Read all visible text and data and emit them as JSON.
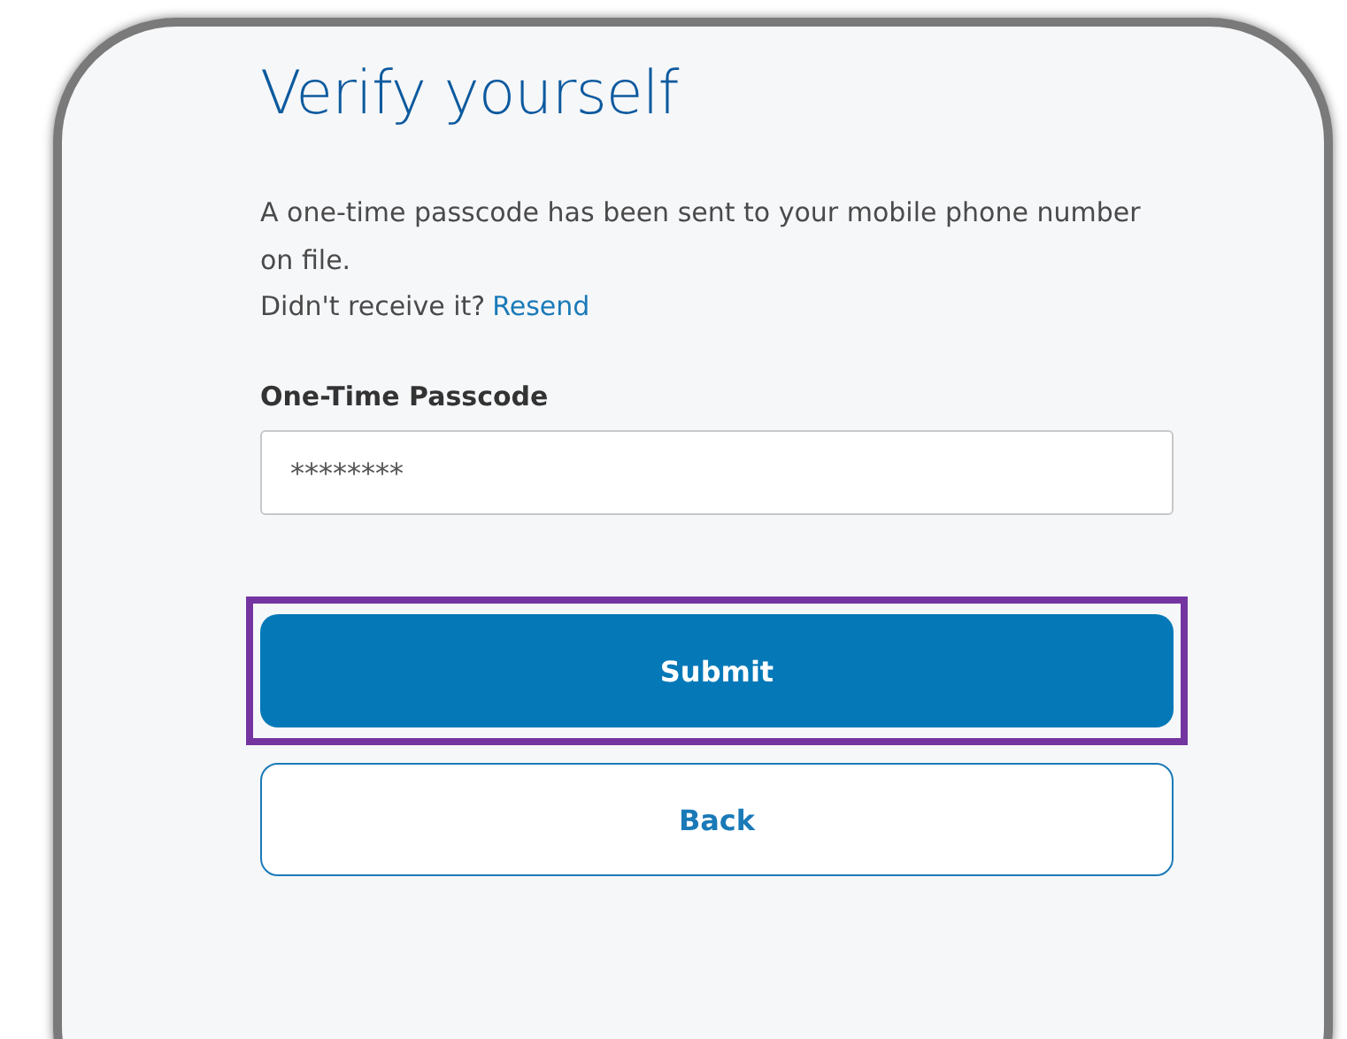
{
  "title": "Verify yourself",
  "message": "A one-time passcode has been sent to your mobile phone number on file.",
  "resend_prompt": "Didn't receive it?",
  "resend_link": "Resend",
  "passcode_field": {
    "label": "One-Time Passcode",
    "value": "********"
  },
  "buttons": [
    {
      "label": "Submit",
      "kind": "primary",
      "highlighted": true
    },
    {
      "label": "Back",
      "kind": "secondary",
      "highlighted": false
    }
  ]
}
